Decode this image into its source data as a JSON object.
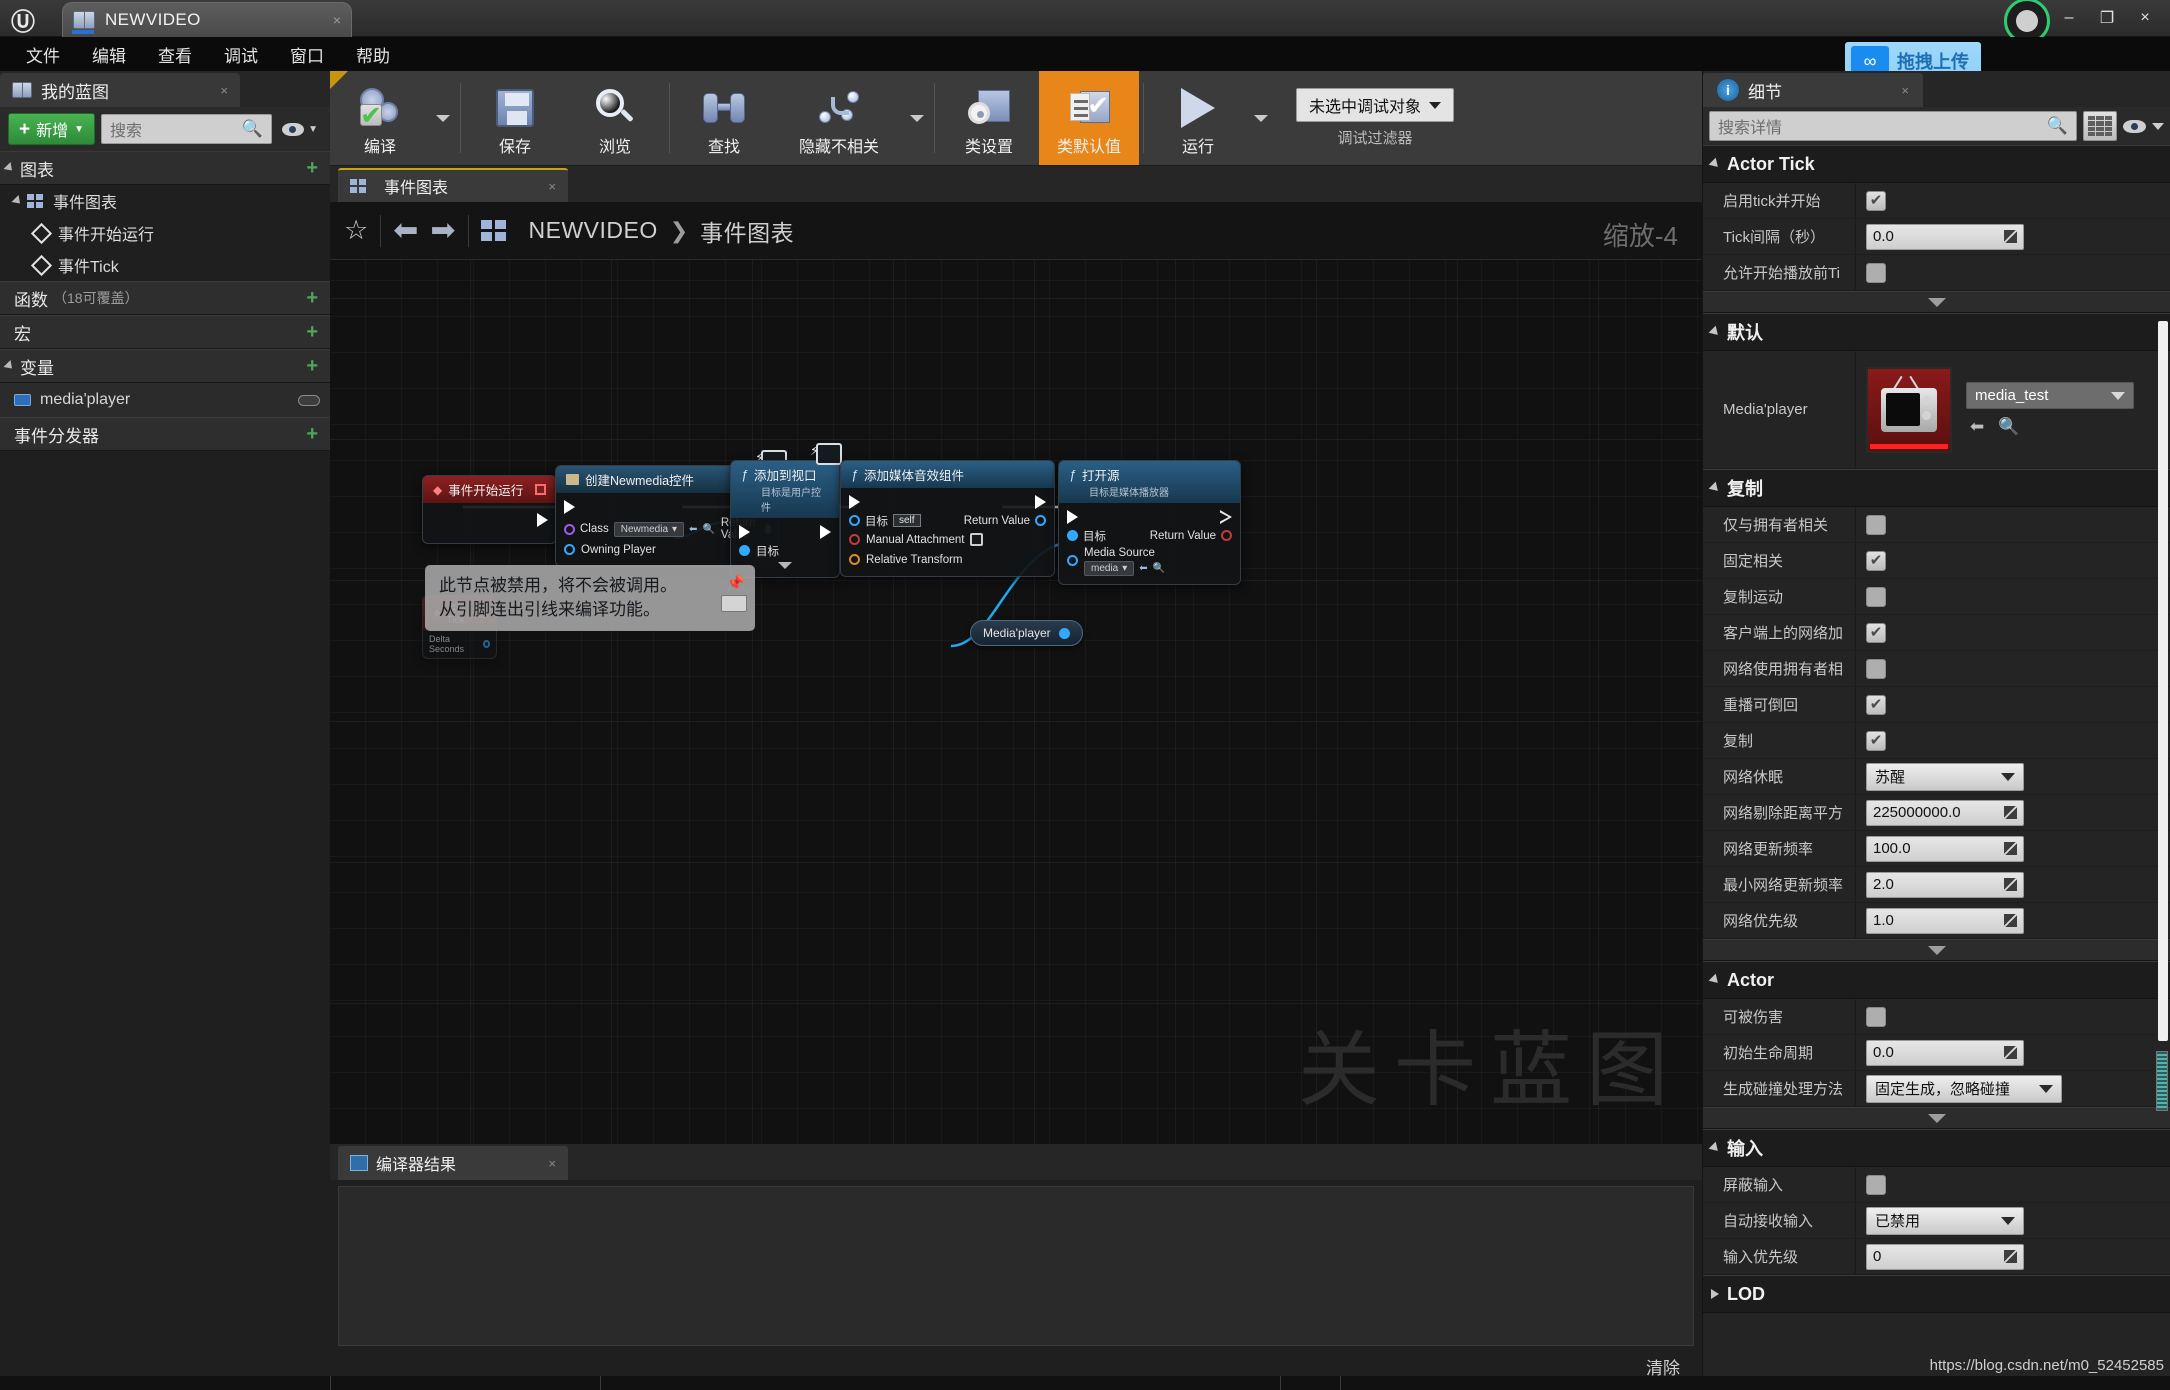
{
  "window": {
    "tab_title": "NEWVIDEO",
    "close_glyph": "×",
    "minimize_glyph": "–",
    "maximize_glyph": "❐",
    "logo_glyph": "Ⓤ"
  },
  "menubar": [
    "文件",
    "编辑",
    "查看",
    "调试",
    "窗口",
    "帮助"
  ],
  "overlay": {
    "upload_label": "拖拽上传",
    "upload_icon": "link-icon"
  },
  "myblueprint": {
    "tab_label": "我的蓝图",
    "add_button": "新增",
    "search_placeholder": "搜索",
    "sections": [
      {
        "name": "图表",
        "sub": "",
        "items": [
          {
            "label": "事件图表",
            "icon": "graph-icon",
            "level": 1
          },
          {
            "label": "事件开始运行",
            "icon": "event-diamond-icon",
            "level": 2
          },
          {
            "label": "事件Tick",
            "icon": "event-diamond-icon",
            "level": 2
          }
        ]
      },
      {
        "name": "函数",
        "sub": "（18可覆盖）",
        "items": []
      },
      {
        "name": "宏",
        "sub": "",
        "items": []
      },
      {
        "name": "变量",
        "sub": "",
        "items": [
          {
            "label": "media'player",
            "icon": "variable-icon",
            "level": 1
          }
        ]
      },
      {
        "name": "事件分发器",
        "sub": "",
        "items": []
      }
    ]
  },
  "toolbar": {
    "buttons": [
      {
        "label": "编译",
        "icon": "compile-gears-icon",
        "selected": false,
        "caret": true
      },
      {
        "label": "保存",
        "icon": "save-floppy-icon",
        "selected": false,
        "caret": false
      },
      {
        "label": "浏览",
        "icon": "browse-magnifier-icon",
        "selected": false,
        "caret": false
      },
      {
        "label": "查找",
        "icon": "find-binoculars-icon",
        "selected": false,
        "caret": false
      },
      {
        "label": "隐藏不相关",
        "icon": "hide-unrelated-icon",
        "selected": false,
        "caret": true
      },
      {
        "label": "类设置",
        "icon": "class-settings-icon",
        "selected": false,
        "caret": false
      },
      {
        "label": "类默认值",
        "icon": "class-defaults-icon",
        "selected": true,
        "caret": false
      },
      {
        "label": "运行",
        "icon": "play-icon",
        "selected": false,
        "caret": true
      }
    ],
    "debug_target": "未选中调试对象",
    "debug_filter_label": "调试过滤器"
  },
  "graph": {
    "tab_label": "事件图表",
    "breadcrumb": [
      "NEWVIDEO",
      "事件图表"
    ],
    "breadcrumb_sep": "❯",
    "zoom_label": "缩放-4",
    "watermark": "关卡蓝图",
    "star_glyph": "☆",
    "back_glyph": "⬅",
    "forward_glyph": "➡",
    "nodes": [
      {
        "id": "event-begin-play",
        "type": "event",
        "title": "事件开始运行",
        "subtitle": "",
        "outputs": [
          "exec"
        ],
        "inputs": []
      },
      {
        "id": "create-newmedia-widget",
        "type": "widget",
        "title": "创建Newmedia控件",
        "subtitle": "",
        "inputs": [
          {
            "label": "Class",
            "pin": "class-pin",
            "value": "Newmedia"
          },
          {
            "label": "Owning Player",
            "pin": "object-pin",
            "value": ""
          }
        ],
        "outputs": [
          {
            "label": "Return Value",
            "pin": "object-pin"
          }
        ]
      },
      {
        "id": "add-to-viewport",
        "type": "function",
        "title": "添加到视口",
        "subtitle": "目标是用户控件",
        "inputs": [
          {
            "label": "目标",
            "pin": "object-pin",
            "value": ""
          }
        ],
        "outputs": []
      },
      {
        "id": "add-media-sound-component",
        "type": "function",
        "title": "添加媒体音效组件",
        "subtitle": "",
        "inputs": [
          {
            "label": "目标",
            "pin": "object-pin",
            "value": "self"
          },
          {
            "label": "Manual Attachment",
            "pin": "bool-pin",
            "value": ""
          },
          {
            "label": "Relative Transform",
            "pin": "struct-pin",
            "value": ""
          }
        ],
        "outputs": [
          {
            "label": "Return Value",
            "pin": "object-pin"
          }
        ]
      },
      {
        "id": "open-source",
        "type": "function",
        "title": "打开源",
        "subtitle": "目标是媒体播放器",
        "inputs": [
          {
            "label": "目标",
            "pin": "object-pin",
            "value": ""
          },
          {
            "label": "Media Source",
            "pin": "object-pin",
            "value": "media"
          }
        ],
        "outputs": [
          {
            "label": "Return Value",
            "pin": "bool-pin"
          }
        ]
      },
      {
        "id": "event-tick",
        "type": "event",
        "title": "事件Tick",
        "subtitle": "",
        "outputs": [
          {
            "label": "Delta Seconds",
            "pin": "float-pin"
          }
        ]
      },
      {
        "id": "media-player-variable",
        "type": "variable",
        "title": "Media'player"
      }
    ],
    "tooltip": {
      "line1": "此节点被禁用，将不会被调用。",
      "line2": "从引脚连出引线来编译功能。",
      "pin_glyph": "📌"
    }
  },
  "compiler": {
    "tab_label": "编译器结果",
    "clear_label": "清除",
    "messages": []
  },
  "details": {
    "tab_label": "细节",
    "search_placeholder": "搜索详情",
    "watermark_url": "https://blog.csdn.net/m0_52452585",
    "categories": [
      {
        "name": "Actor Tick",
        "collapsed": false,
        "rows": [
          {
            "label": "启用tick并开始",
            "type": "checkbox",
            "value": true
          },
          {
            "label": "Tick间隔（秒）",
            "type": "number",
            "value": "0.0"
          },
          {
            "label": "允许开始播放前Ti",
            "type": "checkbox",
            "value": false
          }
        ],
        "more": true
      },
      {
        "name": "默认",
        "collapsed": false,
        "rows": [
          {
            "label": "Media'player",
            "type": "asset",
            "value": "media_test"
          }
        ],
        "more": false
      },
      {
        "name": "复制",
        "collapsed": false,
        "rows": [
          {
            "label": "仅与拥有者相关",
            "type": "checkbox",
            "value": false
          },
          {
            "label": "固定相关",
            "type": "checkbox",
            "value": true
          },
          {
            "label": "复制运动",
            "type": "checkbox",
            "value": false
          },
          {
            "label": "客户端上的网络加",
            "type": "checkbox",
            "value": true
          },
          {
            "label": "网络使用拥有者相",
            "type": "checkbox",
            "value": false
          },
          {
            "label": "重播可倒回",
            "type": "checkbox",
            "value": true
          },
          {
            "label": "复制",
            "type": "checkbox",
            "value": true
          },
          {
            "label": "网络休眠",
            "type": "select",
            "value": "苏醒"
          },
          {
            "label": "网络剔除距离平方",
            "type": "number",
            "value": "225000000.0"
          },
          {
            "label": "网络更新频率",
            "type": "number",
            "value": "100.0"
          },
          {
            "label": "最小网络更新频率",
            "type": "number",
            "value": "2.0"
          },
          {
            "label": "网络优先级",
            "type": "number",
            "value": "1.0"
          }
        ],
        "more": true
      },
      {
        "name": "Actor",
        "collapsed": false,
        "rows": [
          {
            "label": "可被伤害",
            "type": "checkbox",
            "value": false
          },
          {
            "label": "初始生命周期",
            "type": "number",
            "value": "0.0"
          },
          {
            "label": "生成碰撞处理方法",
            "type": "select-wide",
            "value": "固定生成，忽略碰撞"
          }
        ],
        "more": true
      },
      {
        "name": "输入",
        "collapsed": false,
        "rows": [
          {
            "label": "屏蔽输入",
            "type": "checkbox",
            "value": false
          },
          {
            "label": "自动接收输入",
            "type": "select",
            "value": "已禁用"
          },
          {
            "label": "输入优先级",
            "type": "number",
            "value": "0"
          }
        ],
        "more": false
      },
      {
        "name": "LOD",
        "collapsed": true,
        "rows": [],
        "more": false
      }
    ]
  }
}
